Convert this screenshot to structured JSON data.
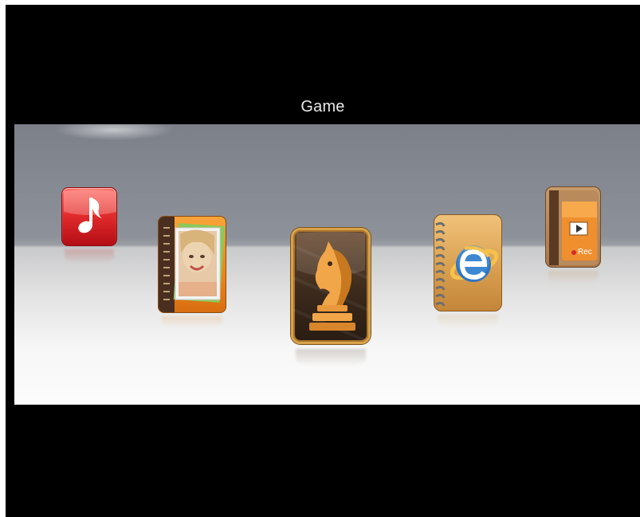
{
  "menu": {
    "title": "Game",
    "selected": "chess-app"
  },
  "apps": [
    {
      "id": "music",
      "icon": "music-note-icon"
    },
    {
      "id": "photo",
      "icon": "photo-album-icon"
    },
    {
      "id": "game",
      "icon": "chess-knight-icon"
    },
    {
      "id": "browser",
      "icon": "browser-e-icon"
    },
    {
      "id": "recorder",
      "icon": "video-record-icon",
      "label": "Rec"
    }
  ],
  "colors": {
    "background": "#000000",
    "shelf_top": "#858992",
    "shelf_floor": "#f4f4f4",
    "music_red": "#d9252a",
    "photo_orange": "#f08a1c",
    "chess_brown": "#3b2a1c",
    "browser_blue": "#2e74c6",
    "recorder_orange": "#ef8a2a"
  }
}
